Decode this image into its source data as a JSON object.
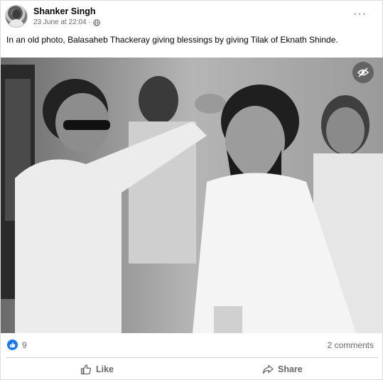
{
  "post": {
    "author": "Shanker Singh",
    "date": "23 June at 22:04",
    "separator": "·",
    "caption": "In an old photo, Balasaheb Thackeray giving blessings by giving Tilak of Eknath Shinde.",
    "reactions_count": "9",
    "comments_count": "2 comments",
    "actions": {
      "like_label": "Like",
      "share_label": "Share"
    },
    "icons": {
      "audience": "globe-icon",
      "menu": "more-options-icon",
      "photo_overlay": "hide-eye-icon",
      "reaction": "thumbs-up-icon"
    },
    "colors": {
      "brand_blue": "#1877f2",
      "secondary_text": "#65676b"
    }
  }
}
